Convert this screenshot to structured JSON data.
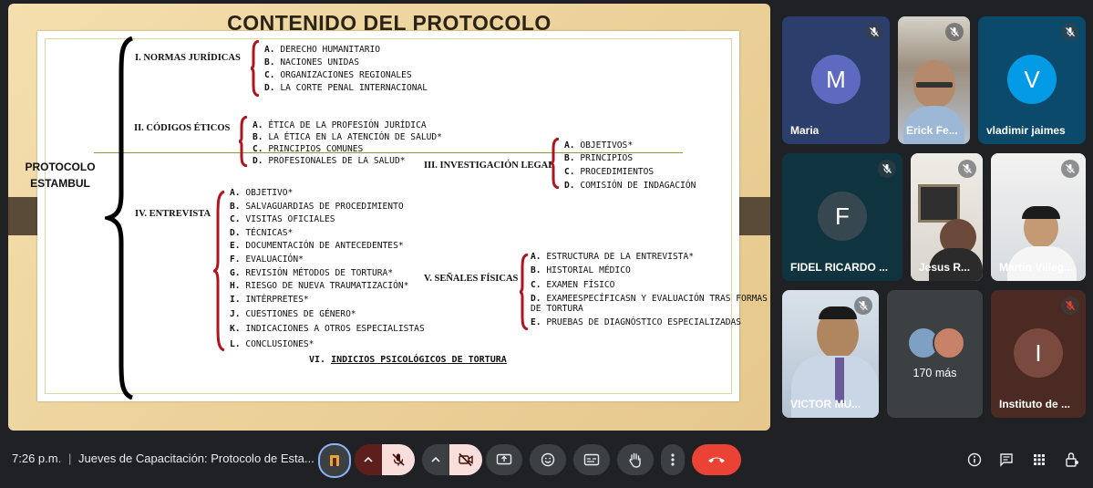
{
  "slide": {
    "title": "CONTENIDO DEL PROTOCOLO",
    "root_line1": "PROTOCOLO",
    "root_line2": "ESTAMBUL",
    "sections": [
      {
        "title": "I. NORMAS JURÍDICAS",
        "items": [
          {
            "letter": "A.",
            "text": " DERECHO HUMANITARIO"
          },
          {
            "letter": "B.",
            "text": " NACIONES UNIDAS"
          },
          {
            "letter": "C.",
            "text": " ORGANIZACIONES REGIONALES"
          },
          {
            "letter": "D.",
            "text": " LA CORTE PENAL INTERNACIONAL"
          }
        ]
      },
      {
        "title": "II. CÓDIGOS ÉTICOS",
        "items": [
          {
            "letter": "A.",
            "text": " ÉTICA DE LA PROFESIÓN JURÍDICA"
          },
          {
            "letter": "B.",
            "text": " LA ÉTICA EN LA ATENCIÓN DE SALUD*"
          },
          {
            "letter": "C.",
            "text": " PRINCIPIOS COMUNES"
          },
          {
            "letter": "D.",
            "text": " PROFESIONALES DE LA SALUD*"
          }
        ]
      },
      {
        "title": "III. INVESTIGACIÓN LEGAL",
        "items": [
          {
            "letter": "A.",
            "text": " OBJETIVOS*"
          },
          {
            "letter": "B.",
            "text": " PRINCIPIOS"
          },
          {
            "letter": "C.",
            "text": "  PROCEDIMIENTOS"
          },
          {
            "letter": "D.",
            "text": " COMISIÓN DE INDAGACIÓN"
          }
        ]
      },
      {
        "title": "IV. ENTREVISTA",
        "items": [
          {
            "letter": "A.",
            "text": " OBJETIVO*"
          },
          {
            "letter": "B.",
            "text": " SALVAGUARDIAS DE PROCEDIMIENTO"
          },
          {
            "letter": "C.",
            "text": " VISITAS OFICIALES"
          },
          {
            "letter": "D.",
            "text": " TÉCNICAS*"
          },
          {
            "letter": "E.",
            "text": " DOCUMENTACIÓN DE ANTECEDENTES*"
          },
          {
            "letter": "F.",
            "text": " EVALUACIÓN*"
          },
          {
            "letter": "G.",
            "text": " REVISIÓN MÉTODOS DE TORTURA*"
          },
          {
            "letter": "H.",
            "text": " RIESGO DE NUEVA TRAUMATIZACIÓN*"
          },
          {
            "letter": "I.",
            "text": "  INTÉRPRETES*"
          },
          {
            "letter": "J.",
            "text": " CUESTIONES DE GÉNERO*"
          },
          {
            "letter": "K.",
            "text": " INDICACIONES A OTROS ESPECIALISTAS"
          },
          {
            "letter": "L.",
            "text": " CONCLUSIONES*"
          }
        ]
      },
      {
        "title": "V. SEÑALES FÍSICAS",
        "items": [
          {
            "letter": "A.",
            "text": " ESTRUCTURA DE LA ENTREVISTA*"
          },
          {
            "letter": "B.",
            "text": " HISTORIAL MÉDICO"
          },
          {
            "letter": "C.",
            "text": " EXAMEN FÍSICO"
          },
          {
            "letter": "D.",
            "text": " EXAMEESPECÍFICASN Y EVALUACIÓN TRAS FORMAS"
          },
          {
            "letter": "",
            "text": "DE TORTURA"
          },
          {
            "letter": "E.",
            "text": " PRUEBAS DE DIAGNÓSTICO ESPECIALIZADAS"
          }
        ]
      }
    ],
    "section6_prefix": "VI. ",
    "section6_underlined": "INDICIOS PSICOLÓGICOS DE TORTURA"
  },
  "participants": [
    {
      "name": "Maria",
      "initial": "M",
      "muted": true,
      "avatar_color": "#5c6bc0",
      "bg": "#2c3e6b"
    },
    {
      "name": "Erick Fe...",
      "muted": true
    },
    {
      "name": "vladimir jaimes",
      "initial": "V",
      "muted": true,
      "avatar_color": "#039be5",
      "bg": "#0b4a6a"
    },
    {
      "name": "FIDEL RICARDO ...",
      "initial": "F",
      "muted": true,
      "avatar_color": "#37474f",
      "bg": "#0f3440"
    },
    {
      "name": "Jesus R...",
      "muted": true
    },
    {
      "name": "Martin Villeg...",
      "muted": true
    },
    {
      "name": "VICTOR MU...",
      "muted": true
    },
    {
      "name": "170 más"
    },
    {
      "name": "Instituto de ...",
      "initial": "I",
      "muted": true,
      "avatar_color": "#7a4a3e",
      "bg": "#4a2a22"
    }
  ],
  "bottom_bar": {
    "time": "7:26 p.m.",
    "separator": "|",
    "meeting_title": "Jueves de Capacitación: Protocolo de Esta..."
  },
  "colors": {
    "red_brace": "#b1141d",
    "end_call": "#ea4335",
    "muted_button": "#f9dedc"
  }
}
